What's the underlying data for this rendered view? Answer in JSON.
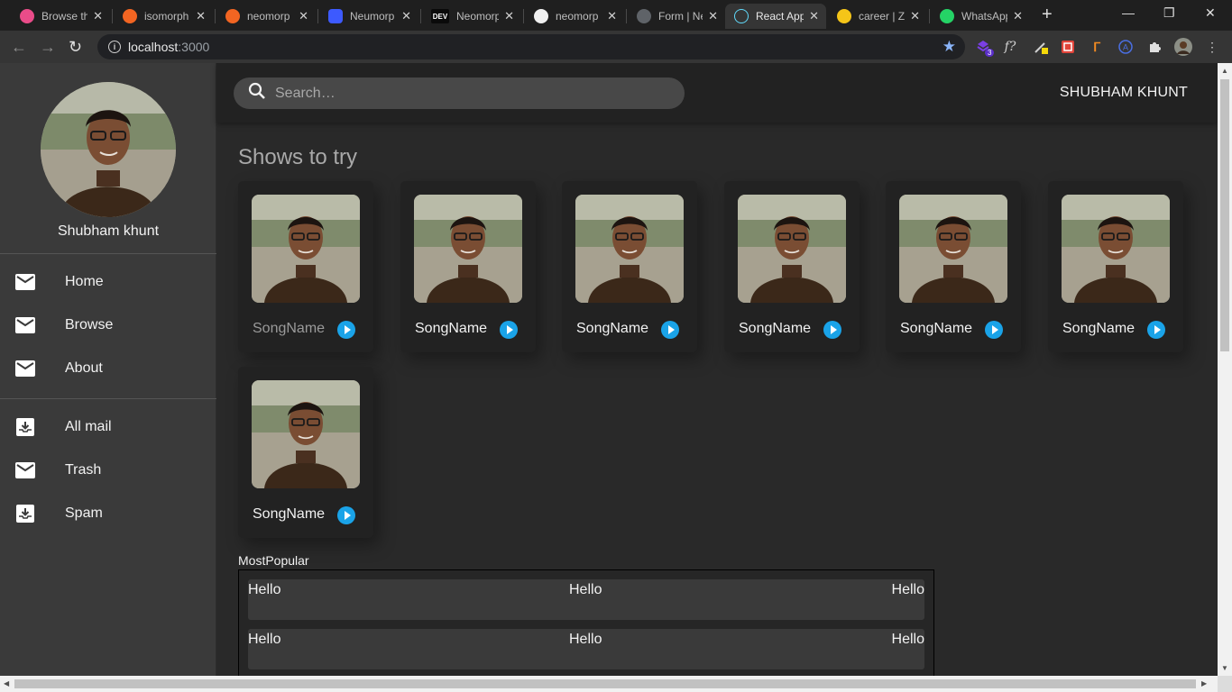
{
  "browser": {
    "tabs": [
      {
        "title": "Browse th",
        "color": "#ea4c89"
      },
      {
        "title": "isomorph",
        "color": "#f26522"
      },
      {
        "title": "neomorp",
        "color": "#f26522"
      },
      {
        "title": "Neumorp",
        "color": "#3d5afe"
      },
      {
        "title": "Neomorp",
        "color": "#0a0a0a",
        "badge": "DEV"
      },
      {
        "title": "neomorp",
        "color": "#f0f0f0"
      },
      {
        "title": "Form | Ne",
        "color": "#5f6368"
      },
      {
        "title": "React App",
        "color": "#61dafb"
      },
      {
        "title": "career | Z",
        "color": "#f5c518"
      },
      {
        "title": "WhatsApp",
        "color": "#25d366"
      }
    ],
    "active_tab": 7,
    "url_host": "localhost",
    "url_port": ":3000",
    "extension_badge": "3"
  },
  "sidebar": {
    "profile_name": "Shubham khunt",
    "primary": [
      {
        "label": "Home",
        "icon": "mail-icon"
      },
      {
        "label": "Browse",
        "icon": "mail-icon"
      },
      {
        "label": "About",
        "icon": "mail-icon"
      }
    ],
    "secondary": [
      {
        "label": "All mail",
        "icon": "inbox-icon"
      },
      {
        "label": "Trash",
        "icon": "mail-icon"
      },
      {
        "label": "Spam",
        "icon": "inbox-icon"
      }
    ]
  },
  "header": {
    "search_placeholder": "Search…",
    "user_name": "SHUBHAM KHUNT"
  },
  "shows": {
    "title": "Shows to try",
    "cards": [
      {
        "name": "SongName"
      },
      {
        "name": "SongName"
      },
      {
        "name": "SongName"
      },
      {
        "name": "SongName"
      },
      {
        "name": "SongName"
      },
      {
        "name": "SongName"
      },
      {
        "name": "SongName"
      }
    ]
  },
  "most_popular": {
    "title": "MostPopular",
    "rows": [
      [
        "Hello",
        "Hello",
        "Hello"
      ],
      [
        "Hello",
        "Hello",
        "Hello"
      ]
    ]
  },
  "colors": {
    "accent": "#1aa3e8",
    "sidebar_bg": "#3a3a3a",
    "appbar_bg": "#222222"
  }
}
